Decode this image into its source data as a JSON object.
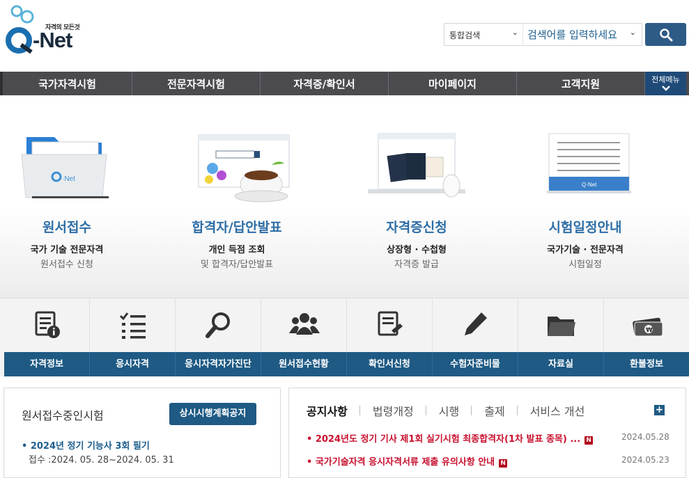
{
  "header": {
    "logo_tagline": "자격의 모든것",
    "logo_brand": "-Net",
    "search_category": "통합검색",
    "search_placeholder": "검색어를 입력하세요"
  },
  "nav": {
    "items": [
      "국가자격시험",
      "전문자격시험",
      "자격증/확인서",
      "마이페이지",
      "고객지원"
    ],
    "all_menu_label": "전체메뉴"
  },
  "services": [
    {
      "title": "원서접수",
      "line1": "국가 기술 전문자격",
      "line2": "원서접수 신청",
      "icon": "folder-illustration"
    },
    {
      "title": "합격자/답안발표",
      "line1": "개인 득점 조회",
      "line2": "및 합격자/답안발표",
      "icon": "browser-coffee-illustration"
    },
    {
      "title": "자격증신청",
      "line1": "상장형 · 수첩형",
      "line2": "자격증 발급",
      "icon": "laptop-passport-illustration"
    },
    {
      "title": "시험일정안내",
      "line1": "국가기술 · 전문자격",
      "line2": "시험일정",
      "icon": "calendar-illustration"
    }
  ],
  "quick_menu": [
    {
      "label": "자격정보",
      "icon": "document-info-icon"
    },
    {
      "label": "응시자격",
      "icon": "checklist-icon"
    },
    {
      "label": "응시자격자가진단",
      "icon": "magnifier-icon"
    },
    {
      "label": "원서접수현황",
      "icon": "people-icon"
    },
    {
      "label": "확인서신청",
      "icon": "document-signed-icon"
    },
    {
      "label": "수험자준비물",
      "icon": "pencil-icon"
    },
    {
      "label": "자료실",
      "icon": "folder-icon"
    },
    {
      "label": "환불정보",
      "icon": "money-icon"
    }
  ],
  "exam_panel": {
    "title": "원서접수중인시험",
    "plan_button": "상시시행계획공지",
    "item": "• 2024년 정기 기능사 3회 필기",
    "date": "접수 :2024. 05. 28~2024. 05. 31"
  },
  "notice_panel": {
    "tabs": [
      "공지사항",
      "법령개정",
      "시행",
      "출제",
      "서비스 개선"
    ],
    "more_label": "+",
    "notices": [
      {
        "text": "2024년도 정기 기사 제1회 실기시험 최종합격자(1차 발표 종목) ...",
        "badge": "N",
        "date": "2024.05.28"
      },
      {
        "text": "국가기술자격 응시자격서류 제출 유의사항 안내",
        "badge": "N",
        "date": "2024.05.23"
      }
    ]
  },
  "colors": {
    "nav_bg": "#4a4a4f",
    "accent_blue": "#1e5a84",
    "title_blue": "#2e6ea6",
    "notice_red": "#c8102e"
  }
}
